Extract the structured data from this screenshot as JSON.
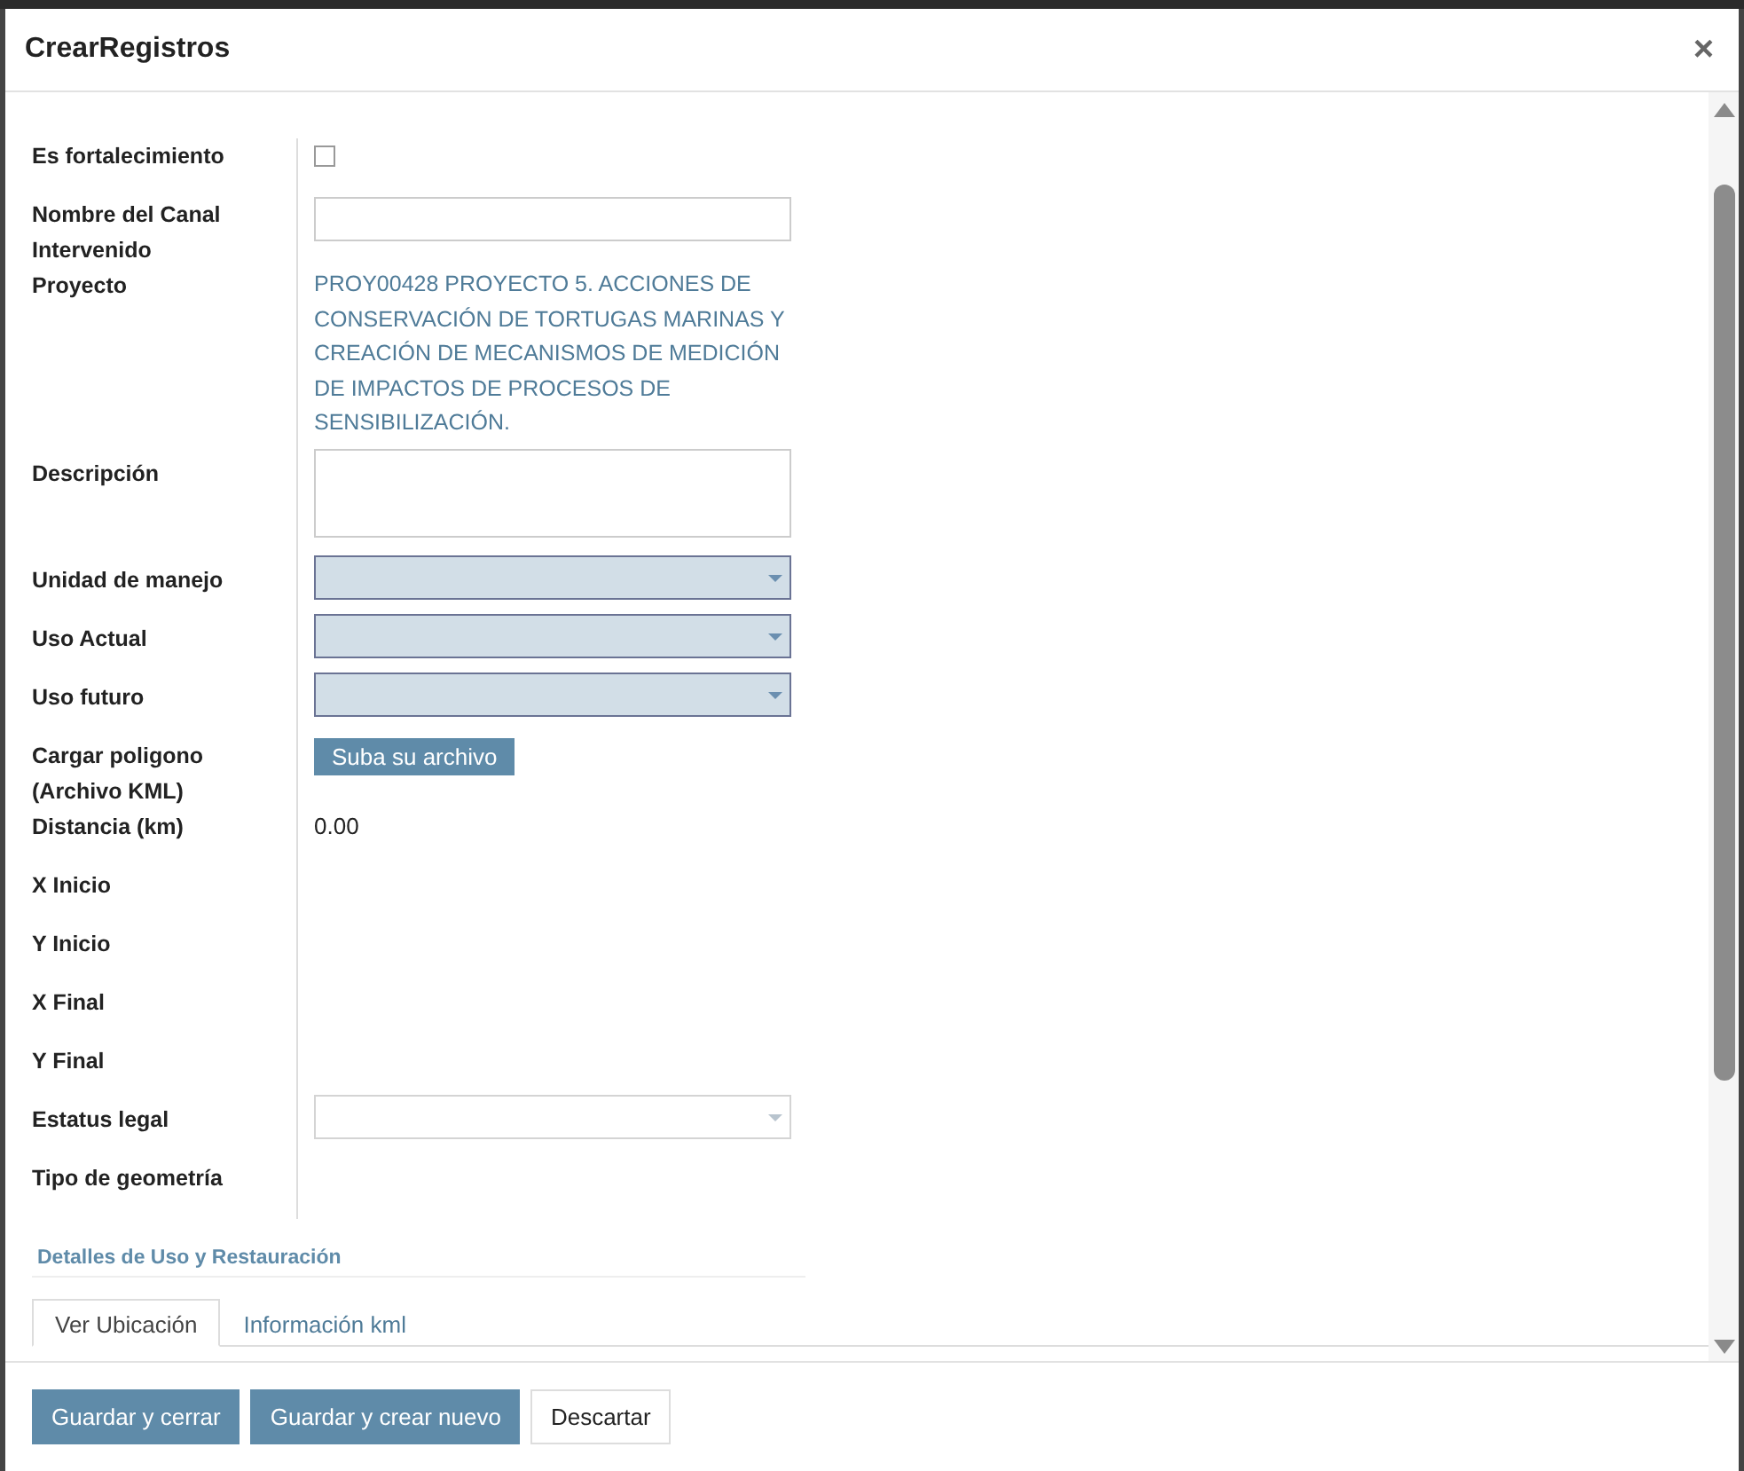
{
  "dialog": {
    "title": "CrearRegistros",
    "close_label": "×"
  },
  "fields": [
    {
      "label": "Es fortalecimiento",
      "kind": "checkbox",
      "checked": false
    },
    {
      "label": "Nombre del Canal Intervenido",
      "kind": "text"
    },
    {
      "label": "Proyecto",
      "kind": "readonly",
      "value": "PROY00428 PROYECTO 5. ACCIONES DE CONSERVACIÓN DE TORTUGAS MARINAS Y CREACIÓN DE MECANISMOS DE MEDICIÓN DE IMPACTOS DE PROCESOS DE SENSIBILIZACIÓN."
    },
    {
      "label": "Descripción",
      "kind": "textarea"
    },
    {
      "label": "Unidad de manejo",
      "kind": "select",
      "required": true
    },
    {
      "label": "Uso Actual",
      "kind": "select",
      "required": true
    },
    {
      "label": "Uso futuro",
      "kind": "select",
      "required": true
    },
    {
      "label": "Cargar poligono (Archivo KML)",
      "kind": "upload",
      "button": "Suba su archivo"
    },
    {
      "label": "Distancia (km)",
      "kind": "value",
      "value": "0.00"
    },
    {
      "label": "X Inicio",
      "kind": "empty"
    },
    {
      "label": "Y Inicio",
      "kind": "empty"
    },
    {
      "label": "X Final",
      "kind": "empty"
    },
    {
      "label": "Y Final",
      "kind": "empty"
    },
    {
      "label": "Estatus legal",
      "kind": "select",
      "required": false
    },
    {
      "label": "Tipo de geometría",
      "kind": "empty"
    }
  ],
  "section_title": "Detalles de Uso y Restauración",
  "tabs": [
    {
      "label": "Ver Ubicación",
      "selected": true
    },
    {
      "label": "Información kml",
      "selected": false
    }
  ],
  "buttons": [
    {
      "label": "Guardar y cerrar",
      "kind": "primary"
    },
    {
      "label": "Guardar y crear nuevo",
      "kind": "primary"
    },
    {
      "label": "Descartar",
      "kind": "secondary"
    }
  ]
}
